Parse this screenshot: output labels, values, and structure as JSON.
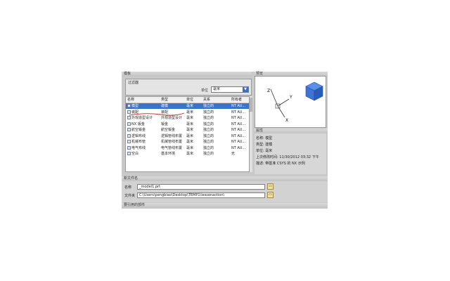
{
  "sections": {
    "templates": "模板",
    "preview": "预览",
    "properties": "属性",
    "new_file_name": "新文件名",
    "reference_part": "要引用的部件"
  },
  "filter": {
    "title": "过滤器",
    "unit_label": "单位",
    "unit_value": "毫米"
  },
  "table": {
    "headers": [
      "名称",
      "类型",
      "单位",
      "关系",
      "所有者"
    ],
    "rows": [
      {
        "name": "模型",
        "type": "建模",
        "unit": "毫米",
        "relation": "独立的",
        "owner": "NT AU...",
        "selected": true
      },
      {
        "name": "装配",
        "type": "装配",
        "unit": "毫米",
        "relation": "独立的",
        "owner": "NT AU..."
      },
      {
        "name": "外观造型设计",
        "type": "外观造型设计",
        "unit": "毫米",
        "relation": "独立的",
        "owner": "NT AU..."
      },
      {
        "name": "NX 钣金",
        "type": "钣金",
        "unit": "毫米",
        "relation": "独立的",
        "owner": "NT AU..."
      },
      {
        "name": "航空钣金",
        "type": "航空钣金",
        "unit": "毫米",
        "relation": "独立的",
        "owner": "NT AU..."
      },
      {
        "name": "逻辑布线",
        "type": "逻辑管线布置",
        "unit": "毫米",
        "relation": "独立的",
        "owner": "NT AU..."
      },
      {
        "name": "机械布管",
        "type": "机械管线布置",
        "unit": "毫米",
        "relation": "独立的",
        "owner": "NT AU..."
      },
      {
        "name": "电气布线",
        "type": "电气管线布置",
        "unit": "毫米",
        "relation": "独立的",
        "owner": "NT AU..."
      },
      {
        "name": "空白",
        "type": "基本环境",
        "unit": "毫米",
        "relation": "独立的",
        "owner": "无"
      }
    ]
  },
  "preview_axes": {
    "z": "Z",
    "y": "Y",
    "x": "X"
  },
  "properties": [
    {
      "label": "名称:",
      "value": "模型"
    },
    {
      "label": "类型:",
      "value": "建模"
    },
    {
      "label": "单位:",
      "value": "毫米"
    },
    {
      "label": "上次修改时间:",
      "value": "11/30/2012 03:32 下午"
    },
    {
      "label": "描述:",
      "value": "带基准 CSYS 的 NX 示例"
    }
  ],
  "new_file": {
    "name_label": "名称",
    "name_value": "_model1.prt",
    "folder_label": "文件夹",
    "folder_value": "C:\\Users\\pengbiao\\Desktop\\TEMP1\\lessonaction\\",
    "browse_icon": "folder-icon"
  },
  "colors": {
    "selection": "#3b73c8",
    "annotation": "#cc2222"
  }
}
